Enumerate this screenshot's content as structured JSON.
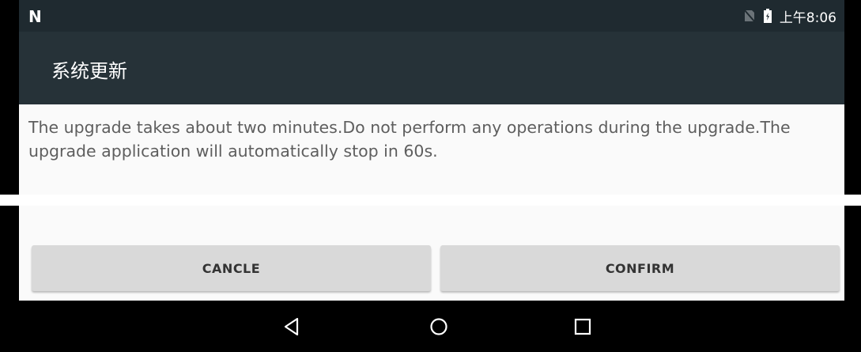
{
  "status_bar": {
    "time": "上午8:06",
    "brand_glyph": "N",
    "icons": [
      "no-sim-icon",
      "battery-icon"
    ]
  },
  "dialog": {
    "title": "系统更新",
    "message": "The upgrade takes about two minutes.Do not perform any operations during the upgrade.The upgrade application will automatically stop in 60s.",
    "buttons": {
      "cancel_label": "CANCLE",
      "confirm_label": "CONFIRM"
    }
  },
  "nav_bar": {
    "icons": [
      "back-icon",
      "home-icon",
      "recents-icon"
    ]
  },
  "colors": {
    "status_bar_bg": "#1f2a30",
    "title_bar_bg": "#263238",
    "panel_bg": "#fafafa",
    "button_bg": "#d9d9d9",
    "text_gray": "#5e5e5e"
  }
}
